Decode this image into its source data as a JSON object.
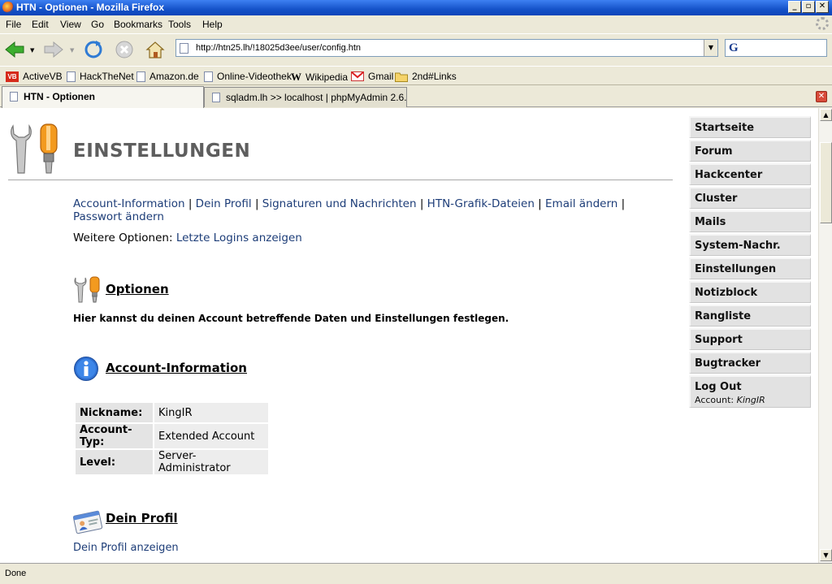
{
  "window": {
    "title": "HTN - Optionen - Mozilla Firefox"
  },
  "menu": [
    "File",
    "Edit",
    "View",
    "Go",
    "Bookmarks",
    "Tools",
    "Help"
  ],
  "address": {
    "url": "http://htn25.lh/!18025d3ee/user/config.htn"
  },
  "bookmarks": [
    "ActiveVB",
    "HackTheNet",
    "Amazon.de",
    "Online-Videothek",
    "Wikipedia",
    "Gmail",
    "2nd#Links"
  ],
  "tabs": [
    {
      "label": "HTN - Optionen",
      "active": true
    },
    {
      "label": "sqladm.lh >> localhost | phpMyAdmin 2.6....",
      "active": false
    }
  ],
  "page": {
    "title": "EINSTELLUNGEN",
    "links": [
      "Account-Information",
      "Dein Profil",
      "Signaturen und Nachrichten",
      "HTN-Grafik-Dateien",
      "Email ändern",
      "Passwort ändern"
    ],
    "more_label": "Weitere Optionen:",
    "more_link": "Letzte Logins anzeigen",
    "options_heading": "Optionen",
    "options_desc": "Hier kannst du deinen Account betreffende Daten und Einstellungen festlegen.",
    "account_heading": "Account-Information",
    "account": [
      {
        "key": "Nickname:",
        "value": "KingIR"
      },
      {
        "key": "Account-Typ:",
        "value": "Extended Account"
      },
      {
        "key": "Level:",
        "value": "Server-Administrator"
      }
    ],
    "profile_heading": "Dein Profil",
    "profile_link": "Dein Profil anzeigen"
  },
  "sidenav": {
    "items": [
      "Startseite",
      "Forum",
      "Hackcenter",
      "Cluster",
      "Mails",
      "System-Nachr.",
      "Einstellungen",
      "Notizblock",
      "Rangliste",
      "Support",
      "Bugtracker"
    ],
    "logout": "Log Out",
    "account_label": "Account:",
    "account_name": "KingIR"
  },
  "status": "Done",
  "colors": {
    "link": "#1d3d78",
    "titlebar": "#0b44b8"
  }
}
